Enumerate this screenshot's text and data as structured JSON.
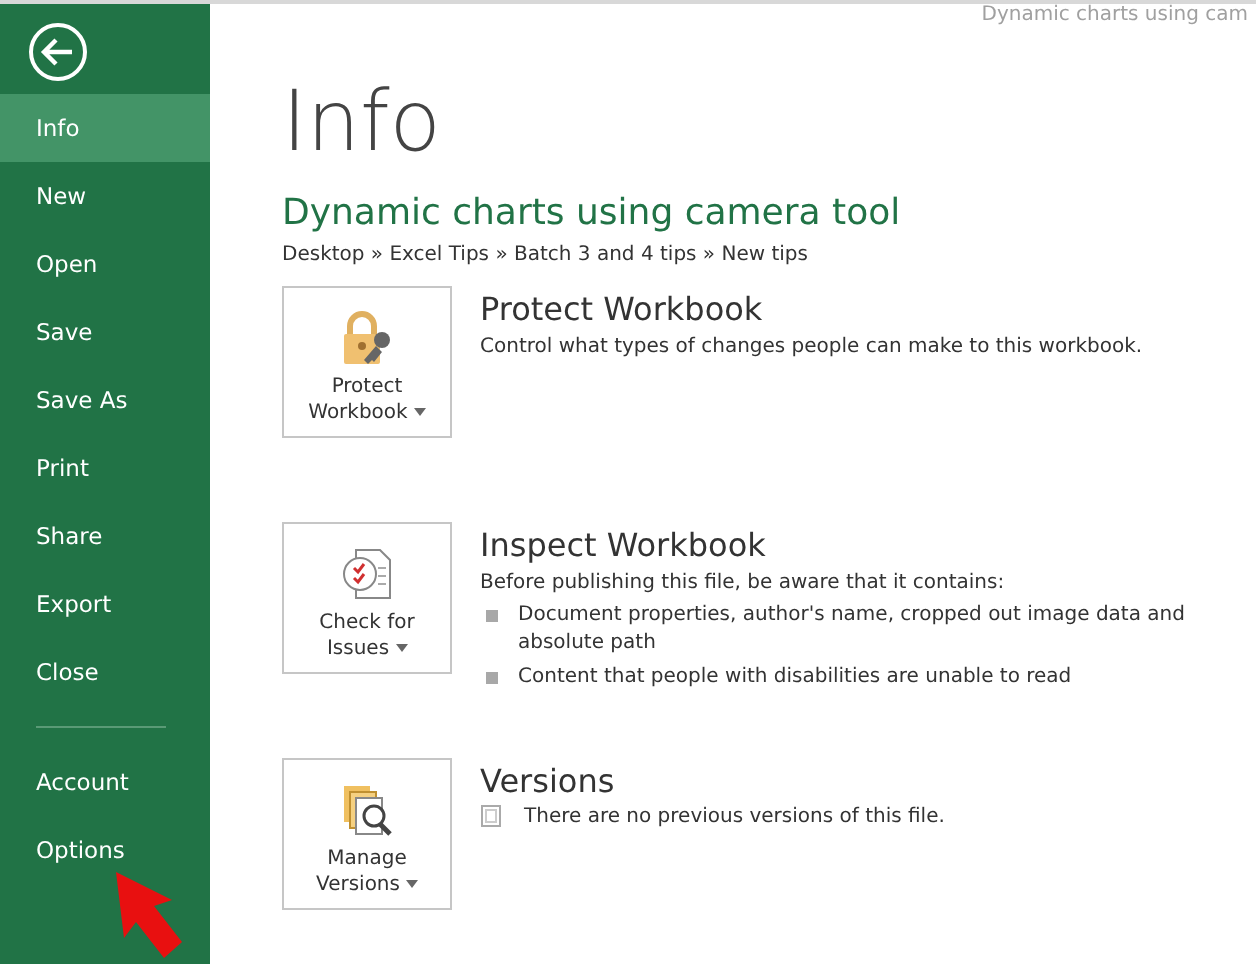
{
  "window": {
    "title": "Dynamic charts using cam"
  },
  "sidebar": {
    "items": [
      {
        "label": "Info",
        "selected": true
      },
      {
        "label": "New",
        "selected": false
      },
      {
        "label": "Open",
        "selected": false
      },
      {
        "label": "Save",
        "selected": false
      },
      {
        "label": "Save As",
        "selected": false
      },
      {
        "label": "Print",
        "selected": false
      },
      {
        "label": "Share",
        "selected": false
      },
      {
        "label": "Export",
        "selected": false
      },
      {
        "label": "Close",
        "selected": false
      }
    ],
    "bottom_items": [
      {
        "label": "Account",
        "selected": false
      },
      {
        "label": "Options",
        "selected": false
      }
    ]
  },
  "page": {
    "title": "Info",
    "document_title": "Dynamic charts using camera tool",
    "path": "Desktop » Excel Tips » Batch 3 and 4 tips » New tips"
  },
  "sections": [
    {
      "kind": "protect",
      "button": "Protect Workbook",
      "heading": "Protect Workbook",
      "description": "Control what types of changes people can make to this workbook."
    },
    {
      "kind": "inspect",
      "button": "Check for Issues",
      "heading": "Inspect Workbook",
      "description": "Before publishing this file, be aware that it contains:",
      "bullets": [
        "Document properties, author's name, cropped out image data and absolute path",
        "Content that people with disabilities are unable to read"
      ]
    },
    {
      "kind": "versions",
      "button": "Manage Versions",
      "heading": "Versions",
      "notes": [
        "There are no previous versions of this file."
      ]
    }
  ]
}
